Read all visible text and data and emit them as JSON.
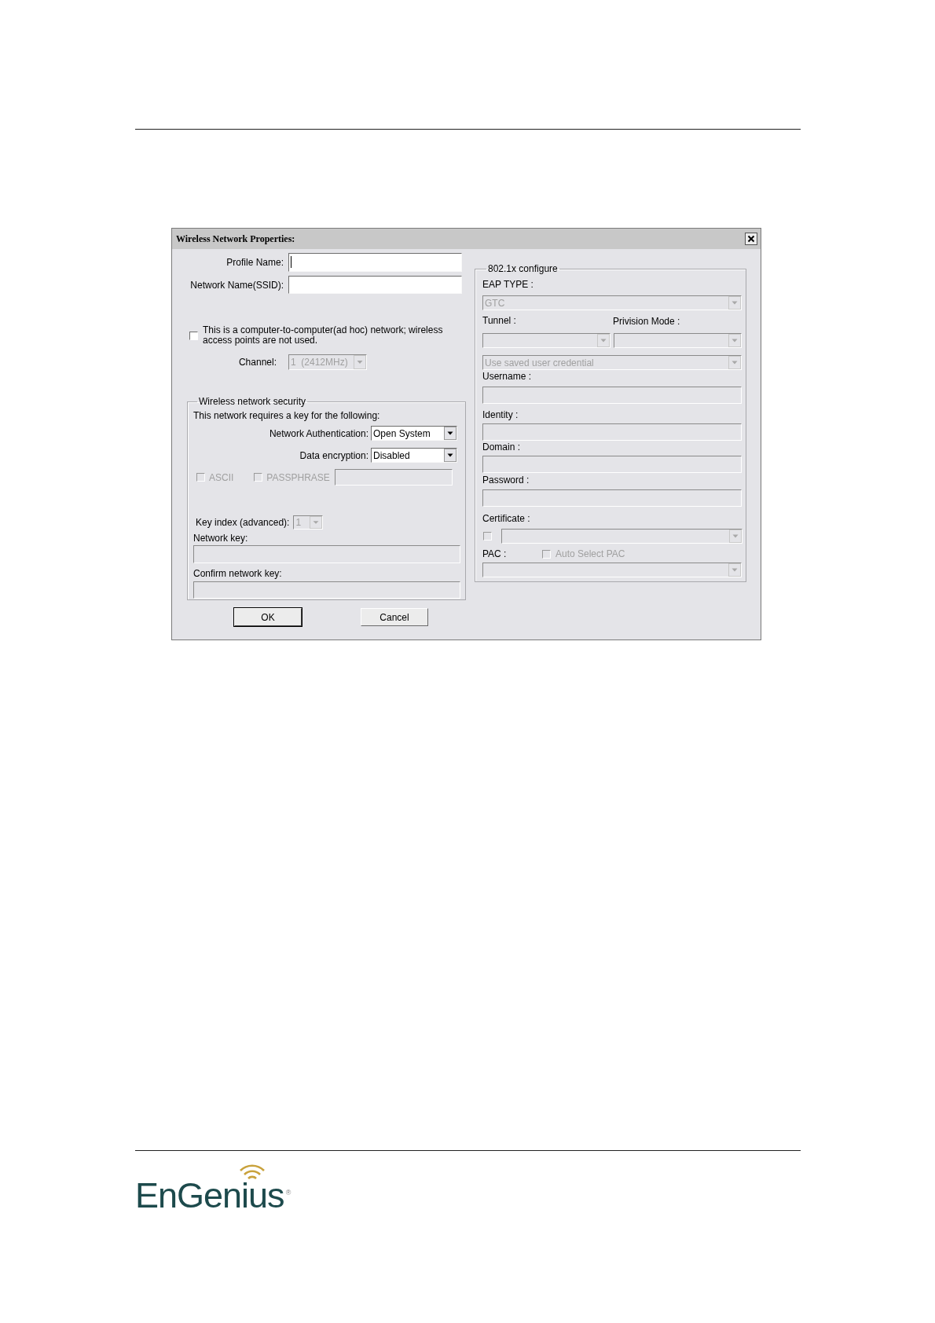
{
  "dialog": {
    "title": "Wireless Network Properties:",
    "profile_name": {
      "label": "Profile Name:",
      "focused": true
    },
    "network_name": {
      "label": "Network Name(SSID):",
      "focused": false
    },
    "adhoc": {
      "label": "This is a computer-to-computer(ad hoc) network; wireless access points are not used.",
      "checked": false
    },
    "channel": {
      "label": "Channel:",
      "value": "1  (2412MHz)",
      "disabled": true
    },
    "security": {
      "legend": "Wireless network security",
      "intro": "This network requires a key for the following:",
      "authentication": {
        "label": "Network Authentication:",
        "value": "Open System",
        "disabled": false
      },
      "encryption": {
        "label": "Data encryption:",
        "value": "Disabled",
        "disabled": false
      },
      "ascii": {
        "label": "ASCII",
        "checked": false,
        "disabled": true
      },
      "passphrase": {
        "label": "PASSPHRASE",
        "checked": false,
        "disabled": true
      },
      "key_index": {
        "label": "Key index (advanced):",
        "value": "1",
        "disabled": true
      },
      "network_key": {
        "label": "Network key:",
        "disabled": true
      },
      "confirm_key": {
        "label": "Confirm network key:",
        "disabled": true
      }
    },
    "eap": {
      "legend": "802.1x configure",
      "rows": [
        {
          "kind": "label",
          "text": "EAP TYPE :"
        },
        {
          "kind": "select",
          "value": "GTC",
          "disabled": true
        },
        {
          "kind": "label-pair",
          "texts": [
            "Tunnel :",
            "Privision Mode :"
          ]
        },
        {
          "kind": "select-pair",
          "selects": [
            {
              "disabled": true
            },
            {
              "disabled": true
            }
          ]
        },
        {
          "kind": "select",
          "value": "Use saved user credential",
          "disabled": true
        },
        {
          "kind": "label",
          "text": "Username :"
        },
        {
          "kind": "input",
          "disabled": true
        },
        {
          "kind": "label",
          "text": "Identity :"
        },
        {
          "kind": "input",
          "disabled": true
        },
        {
          "kind": "label",
          "text": "Domain :"
        },
        {
          "kind": "input",
          "disabled": true
        },
        {
          "kind": "label",
          "text": "Password :"
        },
        {
          "kind": "input",
          "disabled": true
        },
        {
          "kind": "label",
          "text": "Certificate :"
        },
        {
          "kind": "checkbox-select",
          "checked": false,
          "disabled": true
        },
        {
          "kind": "label-checkbox",
          "text": "PAC :",
          "check_label": "Auto Select PAC",
          "checked": false,
          "disabled": true
        },
        {
          "kind": "select",
          "disabled": true
        }
      ]
    },
    "buttons": [
      {
        "label": "OK",
        "default": true
      },
      {
        "label": "Cancel",
        "default": false
      }
    ]
  },
  "footer": {
    "logo": "EnGenius",
    "logo_mark": "®"
  }
}
